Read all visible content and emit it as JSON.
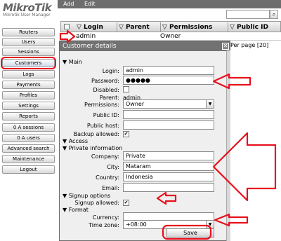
{
  "logo": {
    "name": "MikroTik",
    "subtitle": "Mikrotik User Manager"
  },
  "nav": [
    {
      "label": "Routers"
    },
    {
      "label": "Users"
    },
    {
      "label": "Sessions"
    },
    {
      "label": "Customers"
    },
    {
      "label": "Logs"
    },
    {
      "label": "Payments"
    },
    {
      "label": "Profiles"
    },
    {
      "label": "Settings"
    },
    {
      "label": "Reports"
    },
    {
      "label": "0 A sessions"
    },
    {
      "label": "0 A users"
    },
    {
      "label": "Advanced search"
    },
    {
      "label": "Maintenance"
    },
    {
      "label": "Logout"
    }
  ],
  "toolbar": {
    "add": "Add",
    "edit": "Edit",
    "search_icon": "search-icon"
  },
  "table": {
    "headers": [
      "▽ Login",
      "▽ Parent",
      "▽ Permissions",
      "▽ Public ID"
    ],
    "row": {
      "login": "admin",
      "permissions": "Owner"
    },
    "per_page": "Per page [20]"
  },
  "dialog": {
    "title": "Customer details",
    "close": "✕",
    "main_section": "▼ Main",
    "labels": {
      "login": "Login:",
      "password": "Password:",
      "disabled": "Disabled:",
      "parent": "Parent:",
      "permissions": "Permissions:",
      "public_id": "Public ID:",
      "public_host": "Public host:",
      "backup": "Backup allowed:",
      "company": "Company:",
      "city": "City:",
      "country": "Country:",
      "email": "Email:",
      "signup": "Signup allowed:",
      "currency": "Currency:",
      "timezone": "Time zone:"
    },
    "values": {
      "login": "admin",
      "password": "●●●●●",
      "parent": "admin",
      "permissions": "Owner",
      "public_id": "",
      "public_host": "",
      "company": "Private",
      "city": "Mataram",
      "country": "Indonesia",
      "email": "",
      "currency": "",
      "timezone": "+08:00"
    },
    "checkmark": "✔",
    "sections": {
      "access": "▼ Access",
      "private": "▼ Private information",
      "signup": "▼ Signup options",
      "format": "▼ Format"
    },
    "save": "Save"
  },
  "accent_color": "#e8101c"
}
